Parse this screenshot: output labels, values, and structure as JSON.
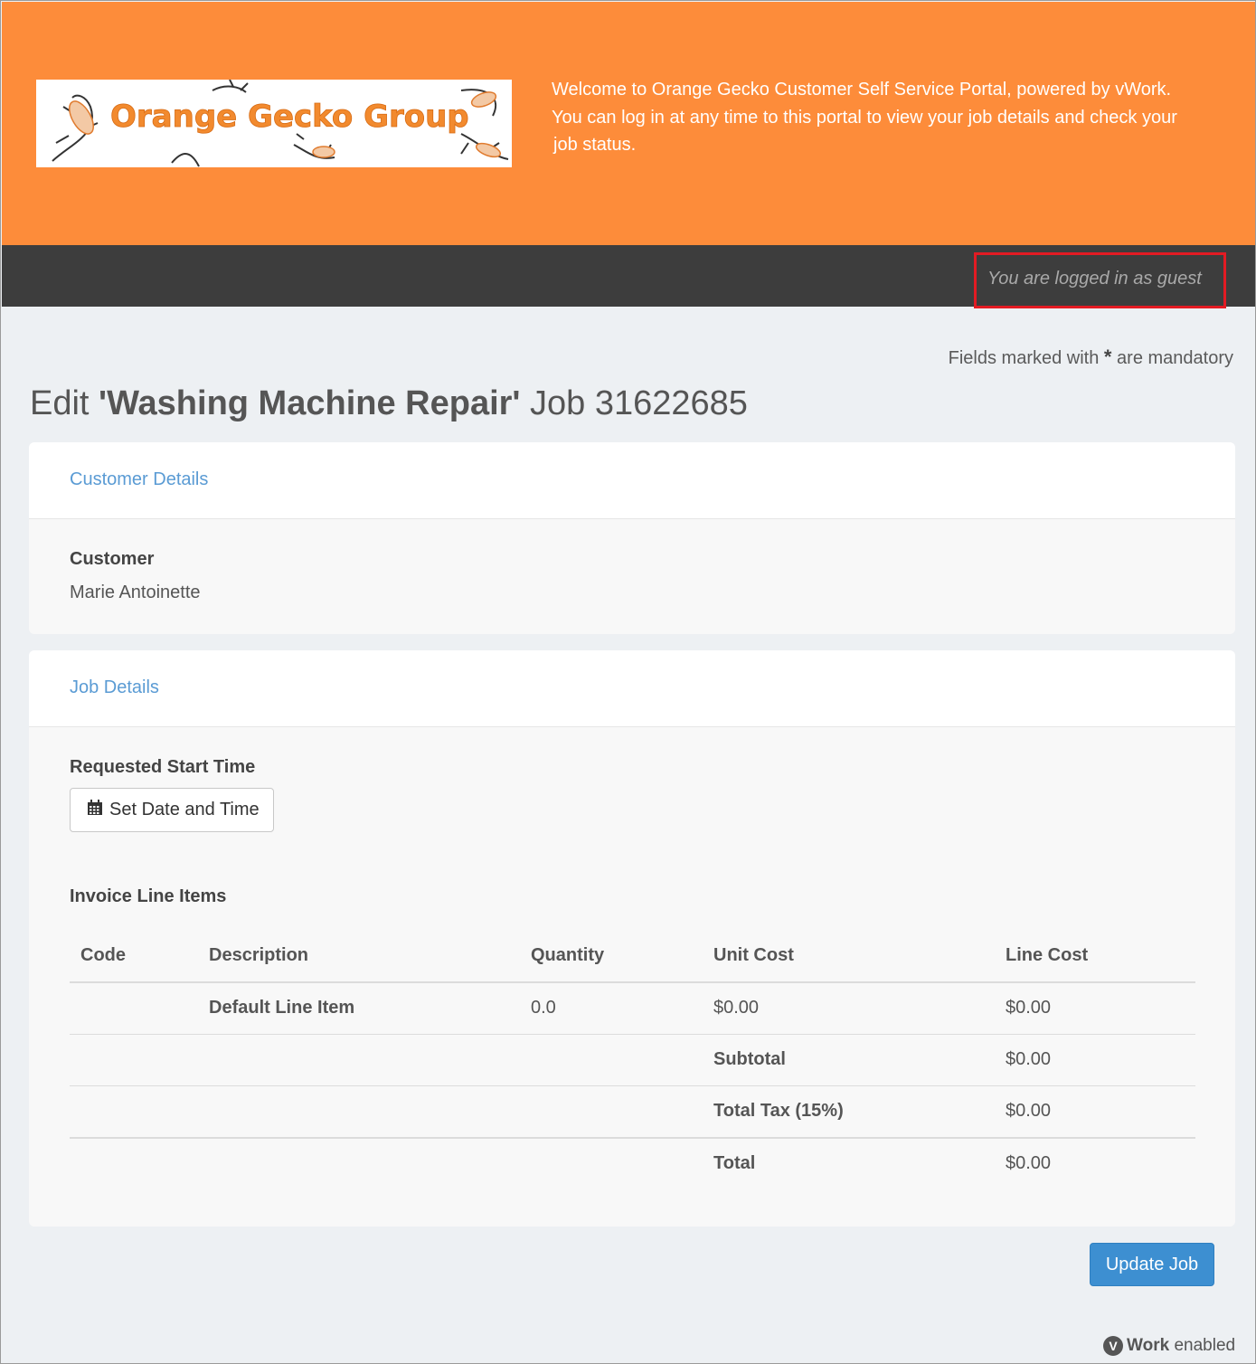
{
  "header": {
    "logo_text": "Orange Gecko Group",
    "welcome_lines": [
      "Welcome to Orange Gecko Customer Self Service Portal, powered by vWork.",
      "You can log in at any time to this portal to view your job details and check your",
      "job status."
    ]
  },
  "topbar": {
    "login_status": "You are logged in as guest"
  },
  "form": {
    "mandatory_prefix": "Fields marked with",
    "mandatory_star": "*",
    "mandatory_suffix": "are mandatory"
  },
  "title": {
    "prefix": "Edit",
    "job_name": "'Washing Machine Repair'",
    "job_label": "Job 31622685"
  },
  "customer_panel": {
    "heading": "Customer Details",
    "customer_label": "Customer",
    "customer_value": "Marie Antoinette"
  },
  "job_panel": {
    "heading": "Job Details",
    "start_time_label": "Requested Start Time",
    "set_date_button": "Set Date and Time",
    "invoice_label": "Invoice Line Items",
    "columns": [
      "Code",
      "Description",
      "Quantity",
      "Unit Cost",
      "Line Cost"
    ],
    "line_items": [
      {
        "code": "",
        "description": "Default Line Item",
        "quantity": "0.0",
        "unit_cost": "$0.00",
        "line_cost": "$0.00"
      }
    ],
    "totals": [
      {
        "label": "Subtotal",
        "value": "$0.00"
      },
      {
        "label": "Total Tax (15%)",
        "value": "$0.00"
      },
      {
        "label": "Total",
        "value": "$0.00"
      }
    ]
  },
  "actions": {
    "update_button": "Update Job"
  },
  "footer": {
    "brand_bold": "Work",
    "brand_rest": " enabled",
    "brand_icon_letter": "V"
  },
  "colors": {
    "header_bg": "#fd8c3a",
    "topbar_bg": "#3d3d3d",
    "highlight_box": "#e31b23",
    "link_blue": "#5a9bd4",
    "primary_button": "#3d8fd1"
  }
}
